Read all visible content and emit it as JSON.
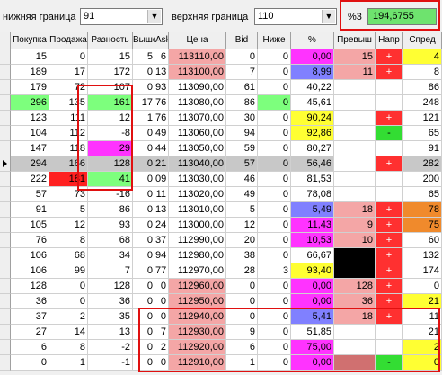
{
  "filters": {
    "lower_label": "нижняя граница",
    "lower_value": "91",
    "upper_label": "верхняя граница",
    "upper_value": "110",
    "percent_label": "%3",
    "percent_value": "194,6755"
  },
  "columns": [
    "",
    "Покупка",
    "Продажа",
    "Разность",
    "Выше",
    "Ask",
    "Цена",
    "Bid",
    "Ниже",
    "%",
    "Превыш",
    "Напр",
    "Спред"
  ],
  "rows": [
    {
      "pokupka": "15",
      "prodaza": "0",
      "raznost": "15",
      "vyshe": "5",
      "ask": "6",
      "cena": "113110,00",
      "bid": "0",
      "nizhe": "0",
      "pct": "0,00",
      "prev": "15",
      "napr": "+",
      "spred": "4"
    },
    {
      "pokupka": "189",
      "prodaza": "17",
      "raznost": "172",
      "vyshe": "0",
      "ask": "13",
      "cena": "113100,00",
      "bid": "7",
      "nizhe": "0",
      "pct": "8,99",
      "prev": "11",
      "napr": "+",
      "spred": "8"
    },
    {
      "pokupka": "179",
      "prodaza": "72",
      "raznost": "107",
      "vyshe": "0",
      "ask": "93",
      "cena": "113090,00",
      "bid": "61",
      "nizhe": "0",
      "pct": "40,22",
      "prev": "",
      "napr": "",
      "spred": "86"
    },
    {
      "pokupka": "296",
      "prodaza": "135",
      "raznost": "161",
      "vyshe": "17",
      "ask": "76",
      "cena": "113080,00",
      "bid": "86",
      "nizhe": "0",
      "pct": "45,61",
      "prev": "",
      "napr": "",
      "spred": "248"
    },
    {
      "pokupka": "123",
      "prodaza": "111",
      "raznost": "12",
      "vyshe": "1",
      "ask": "76",
      "cena": "113070,00",
      "bid": "30",
      "nizhe": "0",
      "pct": "90,24",
      "prev": "",
      "napr": "+",
      "spred": "121"
    },
    {
      "pokupka": "104",
      "prodaza": "112",
      "raznost": "-8",
      "vyshe": "0",
      "ask": "49",
      "cena": "113060,00",
      "bid": "94",
      "nizhe": "0",
      "pct": "92,86",
      "prev": "",
      "napr": "-",
      "spred": "65"
    },
    {
      "pokupka": "147",
      "prodaza": "118",
      "raznost": "29",
      "vyshe": "0",
      "ask": "44",
      "cena": "113050,00",
      "bid": "59",
      "nizhe": "0",
      "pct": "80,27",
      "prev": "",
      "napr": "",
      "spred": "91"
    },
    {
      "pokupka": "294",
      "prodaza": "166",
      "raznost": "128",
      "vyshe": "0",
      "ask": "21",
      "cena": "113040,00",
      "bid": "57",
      "nizhe": "0",
      "pct": "56,46",
      "prev": "",
      "napr": "+",
      "spred": "282"
    },
    {
      "pokupka": "222",
      "prodaza": "181",
      "raznost": "41",
      "vyshe": "0",
      "ask": "09",
      "cena": "113030,00",
      "bid": "46",
      "nizhe": "0",
      "pct": "81,53",
      "prev": "",
      "napr": "",
      "spred": "200"
    },
    {
      "pokupka": "57",
      "prodaza": "73",
      "raznost": "-16",
      "vyshe": "0",
      "ask": "11",
      "cena": "113020,00",
      "bid": "49",
      "nizhe": "0",
      "pct": "78,08",
      "prev": "",
      "napr": "",
      "spred": "65"
    },
    {
      "pokupka": "91",
      "prodaza": "5",
      "raznost": "86",
      "vyshe": "0",
      "ask": "13",
      "cena": "113010,00",
      "bid": "5",
      "nizhe": "0",
      "pct": "5,49",
      "prev": "18",
      "napr": "+",
      "spred": "78"
    },
    {
      "pokupka": "105",
      "prodaza": "12",
      "raznost": "93",
      "vyshe": "0",
      "ask": "24",
      "cena": "113000,00",
      "bid": "12",
      "nizhe": "0",
      "pct": "11,43",
      "prev": "9",
      "napr": "+",
      "spred": "75"
    },
    {
      "pokupka": "76",
      "prodaza": "8",
      "raznost": "68",
      "vyshe": "0",
      "ask": "37",
      "cena": "112990,00",
      "bid": "20",
      "nizhe": "0",
      "pct": "10,53",
      "prev": "10",
      "napr": "+",
      "spred": "60"
    },
    {
      "pokupka": "106",
      "prodaza": "68",
      "raznost": "34",
      "vyshe": "0",
      "ask": "94",
      "cena": "112980,00",
      "bid": "38",
      "nizhe": "0",
      "pct": "66,67",
      "prev": "",
      "napr": "+",
      "spred": "132"
    },
    {
      "pokupka": "106",
      "prodaza": "99",
      "raznost": "7",
      "vyshe": "0",
      "ask": "77",
      "cena": "112970,00",
      "bid": "28",
      "nizhe": "3",
      "pct": "93,40",
      "prev": "",
      "napr": "+",
      "spred": "174"
    },
    {
      "pokupka": "128",
      "prodaza": "0",
      "raznost": "128",
      "vyshe": "0",
      "ask": "0",
      "cena": "112960,00",
      "bid": "0",
      "nizhe": "0",
      "pct": "0,00",
      "prev": "128",
      "napr": "+",
      "spred": "0"
    },
    {
      "pokupka": "36",
      "prodaza": "0",
      "raznost": "36",
      "vyshe": "0",
      "ask": "0",
      "cena": "112950,00",
      "bid": "0",
      "nizhe": "0",
      "pct": "0,00",
      "prev": "36",
      "napr": "+",
      "spred": "21"
    },
    {
      "pokupka": "37",
      "prodaza": "2",
      "raznost": "35",
      "vyshe": "0",
      "ask": "0",
      "cena": "112940,00",
      "bid": "0",
      "nizhe": "0",
      "pct": "5,41",
      "prev": "18",
      "napr": "+",
      "spred": "11"
    },
    {
      "pokupka": "27",
      "prodaza": "14",
      "raznost": "13",
      "vyshe": "0",
      "ask": "7",
      "cena": "112930,00",
      "bid": "9",
      "nizhe": "0",
      "pct": "51,85",
      "prev": "",
      "napr": "",
      "spred": "21"
    },
    {
      "pokupka": "6",
      "prodaza": "8",
      "raznost": "-2",
      "vyshe": "0",
      "ask": "2",
      "cena": "112920,00",
      "bid": "6",
      "nizhe": "0",
      "pct": "75,00",
      "prev": "",
      "napr": "",
      "spred": "2"
    },
    {
      "pokupka": "0",
      "prodaza": "1",
      "raznost": "-1",
      "vyshe": "0",
      "ask": "0",
      "cena": "112910,00",
      "bid": "1",
      "nizhe": "0",
      "pct": "0,00",
      "prev": "",
      "napr": "-",
      "spred": "0"
    }
  ],
  "current_row": 7,
  "colors": {
    "green": "#7dff7d",
    "red": "#ff2020",
    "magenta": "#ff33ff",
    "gray": "#c8c8c8",
    "pink": "#f4a6a6",
    "yellow": "#ffff33",
    "purple_blue": "#8080ff",
    "orange": "#f08a2c",
    "black": "#000000",
    "dull_red": "#d07070",
    "bright_green": "#33dd33",
    "highlight": "#ff3030"
  }
}
